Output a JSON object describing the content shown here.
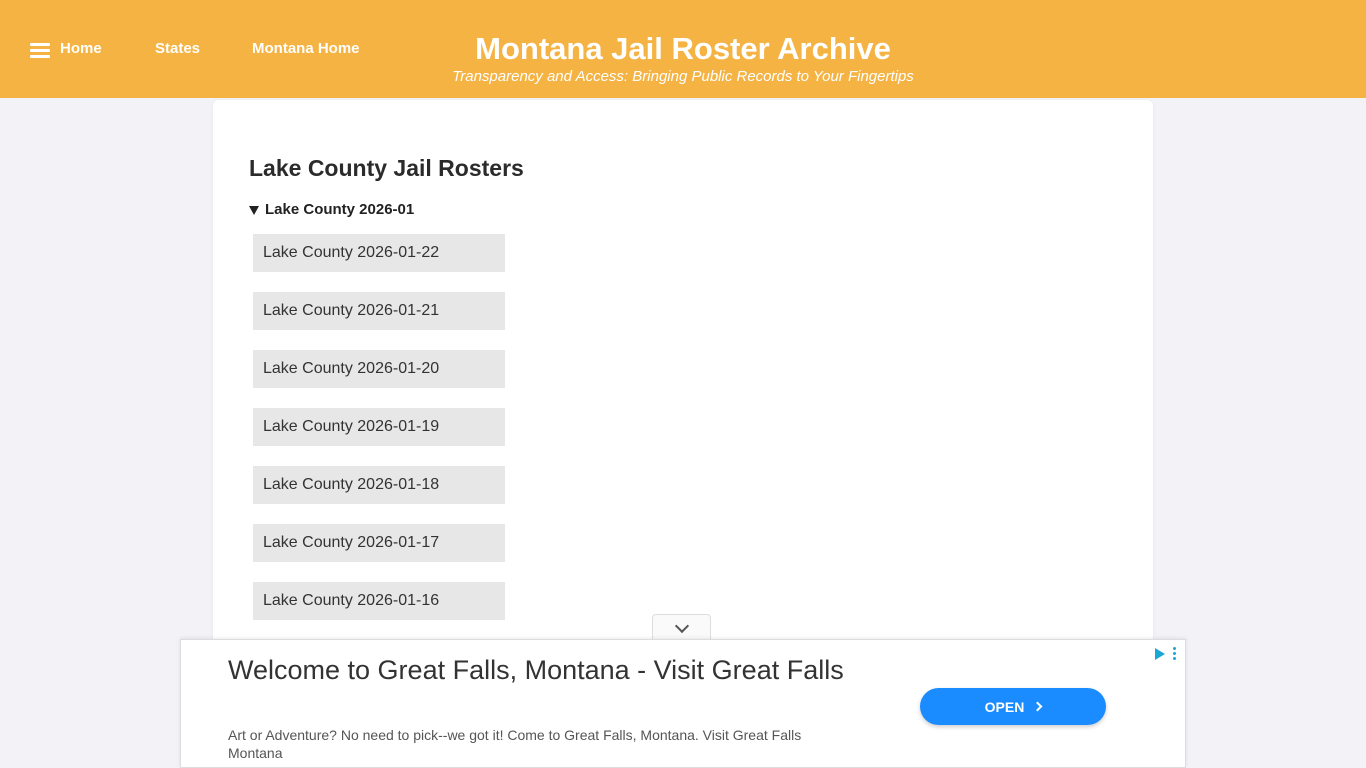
{
  "header": {
    "nav": {
      "home": "Home",
      "states": "States",
      "montana_home": "Montana Home"
    },
    "title": "Montana Jail Roster Archive",
    "subtitle": "Transparency and Access: Bringing Public Records to Your Fingertips"
  },
  "main": {
    "heading": "Lake County Jail Rosters",
    "month_group": "Lake County 2026-01",
    "rosters": [
      "Lake County 2026-01-22",
      "Lake County 2026-01-21",
      "Lake County 2026-01-20",
      "Lake County 2026-01-19",
      "Lake County 2026-01-18",
      "Lake County 2026-01-17",
      "Lake County 2026-01-16"
    ]
  },
  "ad": {
    "title": "Welcome to Great Falls, Montana - Visit Great Falls",
    "description": "Art or Adventure? No need to pick--we got it! Come to Great Falls, Montana. Visit Great Falls Montana",
    "cta": "OPEN"
  },
  "colors": {
    "header_bg": "#f5b343",
    "page_bg": "#f3f3f7",
    "roster_bg": "#e7e7e7",
    "cta_bg": "#1a8cff"
  }
}
